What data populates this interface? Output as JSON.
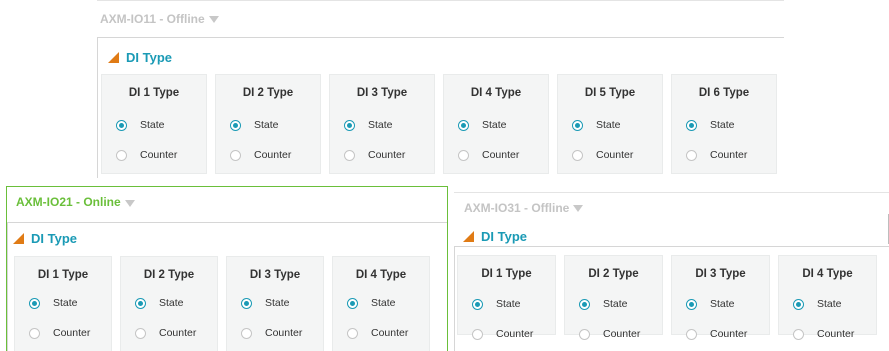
{
  "panels": [
    {
      "device": "AXM-IO11 - Offline",
      "status": "offline",
      "section_title": "DI Type",
      "cards": [
        {
          "title": "DI 1 Type",
          "options": [
            "State",
            "Counter"
          ],
          "selected": "State"
        },
        {
          "title": "DI 2 Type",
          "options": [
            "State",
            "Counter"
          ],
          "selected": "State"
        },
        {
          "title": "DI 3 Type",
          "options": [
            "State",
            "Counter"
          ],
          "selected": "State"
        },
        {
          "title": "DI 4 Type",
          "options": [
            "State",
            "Counter"
          ],
          "selected": "State"
        },
        {
          "title": "DI 5 Type",
          "options": [
            "State",
            "Counter"
          ],
          "selected": "State"
        },
        {
          "title": "DI 6 Type",
          "options": [
            "State",
            "Counter"
          ],
          "selected": "State"
        }
      ]
    },
    {
      "device": "AXM-IO21 - Online",
      "status": "online",
      "section_title": "DI Type",
      "cards": [
        {
          "title": "DI 1 Type",
          "options": [
            "State",
            "Counter"
          ],
          "selected": "State"
        },
        {
          "title": "DI 2 Type",
          "options": [
            "State",
            "Counter"
          ],
          "selected": "State"
        },
        {
          "title": "DI 3 Type",
          "options": [
            "State",
            "Counter"
          ],
          "selected": "State"
        },
        {
          "title": "DI 4 Type",
          "options": [
            "State",
            "Counter"
          ],
          "selected": "State"
        }
      ]
    },
    {
      "device": "AXM-IO31 - Offline",
      "status": "offline",
      "section_title": "DI Type",
      "cards": [
        {
          "title": "DI 1 Type",
          "options": [
            "State",
            "Counter"
          ],
          "selected": "State"
        },
        {
          "title": "DI 2 Type",
          "options": [
            "State",
            "Counter"
          ],
          "selected": "State"
        },
        {
          "title": "DI 3 Type",
          "options": [
            "State",
            "Counter"
          ],
          "selected": "State"
        },
        {
          "title": "DI 4 Type",
          "options": [
            "State",
            "Counter"
          ],
          "selected": "State"
        }
      ]
    }
  ],
  "colors": {
    "online": "#6abf3a",
    "offline": "#c4c4c4",
    "accent": "#1a9ab5",
    "collapse_icon": "#e07b15",
    "card_background": "#f4f5f5"
  },
  "icons": {
    "device_menu": "caret-down-icon",
    "section_toggle": "collapse-triangle-icon",
    "option": "radio-icon"
  }
}
